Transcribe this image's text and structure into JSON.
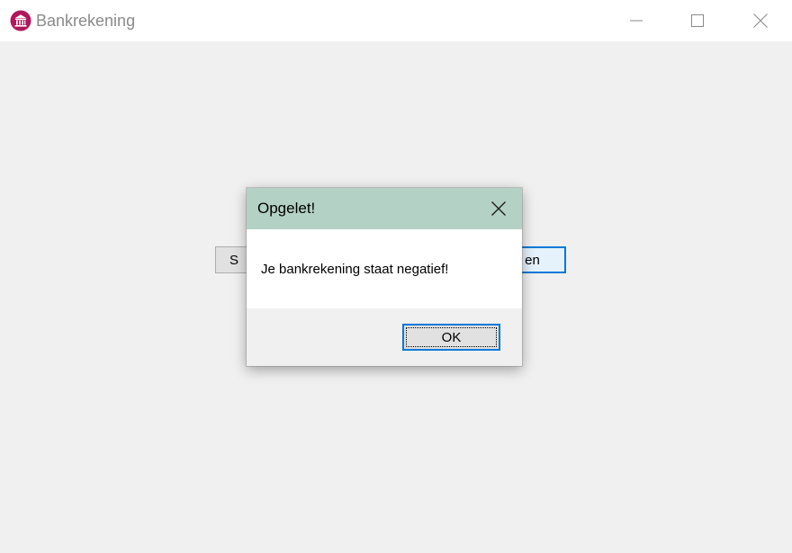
{
  "window": {
    "title": "Bankrekening",
    "icon": "bank-icon",
    "icon_color": "#b0175a",
    "controls": [
      "minimize-icon",
      "maximize-icon",
      "close-icon"
    ]
  },
  "form": {
    "left_button_label": "S",
    "right_button_label": "en"
  },
  "dialog": {
    "title": "Opgelet!",
    "title_bar_color": "#b4d1c6",
    "message": "Je bankrekening staat negatief!",
    "ok_label": "OK",
    "accent_color": "#0078d7"
  }
}
